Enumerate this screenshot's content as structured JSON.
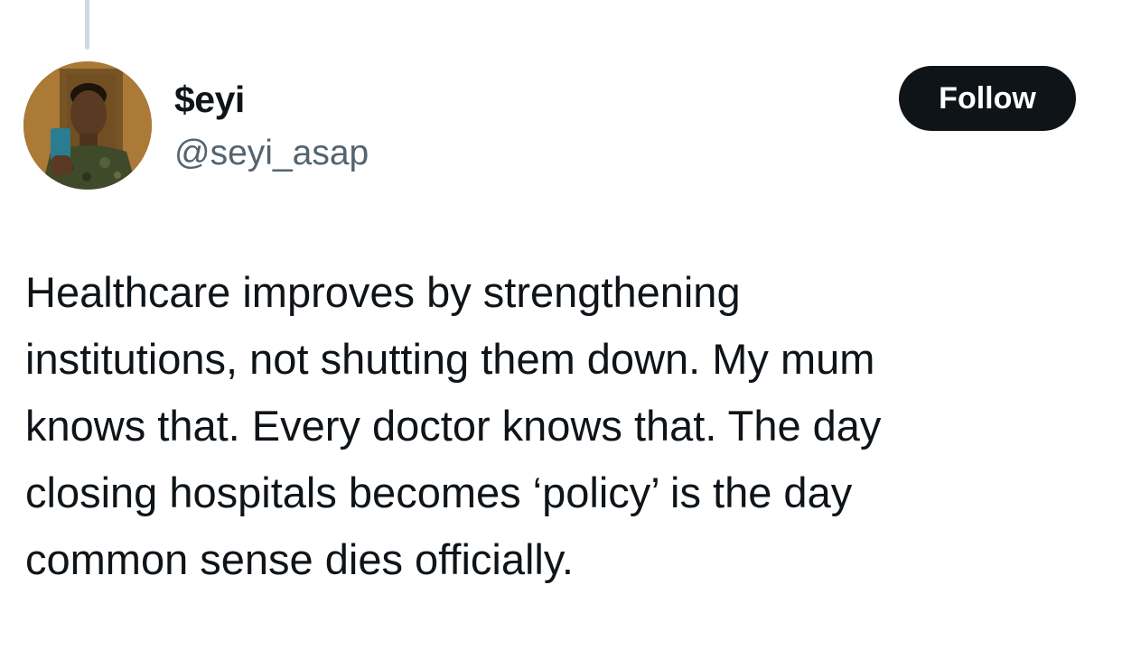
{
  "tweet": {
    "author": {
      "display_name": "$eyi",
      "handle": "@seyi_asap",
      "avatar_icon": "user-avatar-photo"
    },
    "follow_button": {
      "label": "Follow"
    },
    "text_lines": [
      "Healthcare improves by strengthening",
      "institutions, not shutting them down. My mum",
      "knows that. Every doctor knows that. The day",
      "closing hospitals becomes ‘policy’ is the day",
      "common sense dies officially."
    ]
  },
  "colors": {
    "text_primary": "#0f1419",
    "text_secondary": "#536471",
    "button_bg": "#0f1419",
    "button_text": "#ffffff",
    "thread_line": "#cfd9de",
    "background": "#ffffff"
  }
}
